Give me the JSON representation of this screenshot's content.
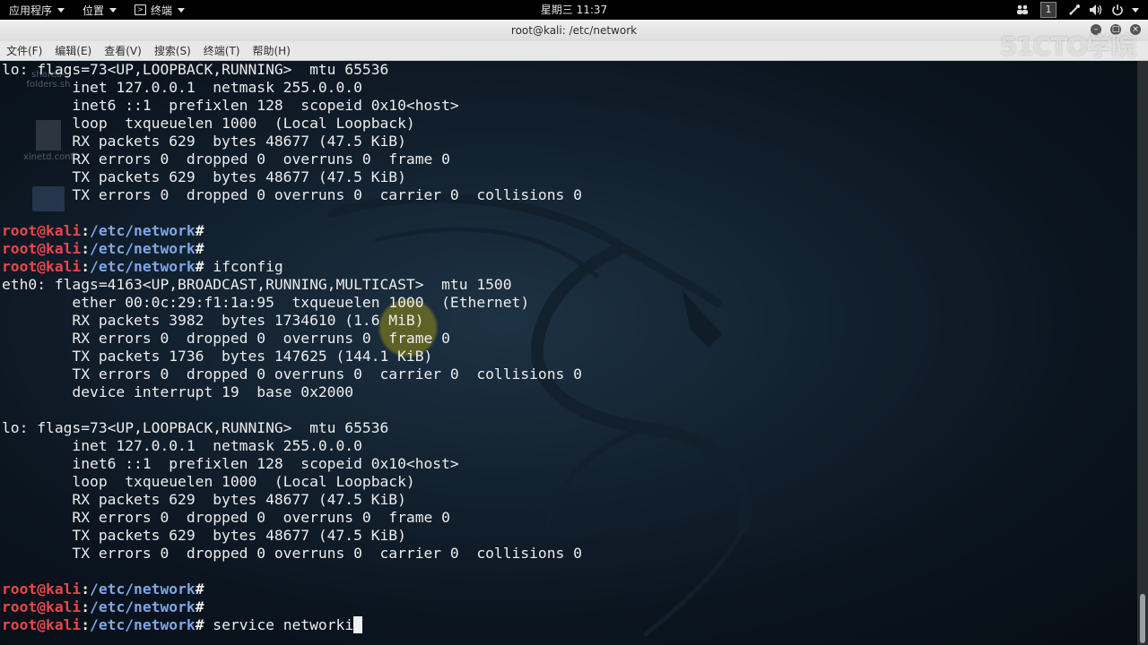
{
  "top_panel": {
    "applications": "应用程序",
    "places": "位置",
    "terminal_app": "终端",
    "clock": "星期三 11:37",
    "workspace": "1"
  },
  "window": {
    "title": "root@kali: /etc/network",
    "menu": [
      "文件(F)",
      "编辑(E)",
      "查看(V)",
      "搜索(S)",
      "终端(T)",
      "帮助(H)"
    ],
    "watermark": "51CTO学院"
  },
  "desktop_icons": [
    {
      "label": "shared-\nfolders.sh"
    },
    {
      "label": "xinetd.conf"
    }
  ],
  "prompt": {
    "user": "root@kali",
    "path": "/etc/network"
  },
  "terminal_lines": [
    {
      "type": "out",
      "text": "lo: flags=73<UP,LOOPBACK,RUNNING>  mtu 65536"
    },
    {
      "type": "out",
      "text": "        inet 127.0.0.1  netmask 255.0.0.0"
    },
    {
      "type": "out",
      "text": "        inet6 ::1  prefixlen 128  scopeid 0x10<host>"
    },
    {
      "type": "out",
      "text": "        loop  txqueuelen 1000  (Local Loopback)"
    },
    {
      "type": "out",
      "text": "        RX packets 629  bytes 48677 (47.5 KiB)"
    },
    {
      "type": "out",
      "text": "        RX errors 0  dropped 0  overruns 0  frame 0"
    },
    {
      "type": "out",
      "text": "        TX packets 629  bytes 48677 (47.5 KiB)"
    },
    {
      "type": "out",
      "text": "        TX errors 0  dropped 0 overruns 0  carrier 0  collisions 0"
    },
    {
      "type": "out",
      "text": ""
    },
    {
      "type": "prompt",
      "cmd": ""
    },
    {
      "type": "prompt",
      "cmd": ""
    },
    {
      "type": "prompt",
      "cmd": " ifconfig"
    },
    {
      "type": "out",
      "text": "eth0: flags=4163<UP,BROADCAST,RUNNING,MULTICAST>  mtu 1500"
    },
    {
      "type": "out",
      "text": "        ether 00:0c:29:f1:1a:95  txqueuelen 1000  (Ethernet)"
    },
    {
      "type": "out",
      "text": "        RX packets 3982  bytes 1734610 (1.6 MiB)"
    },
    {
      "type": "out",
      "text": "        RX errors 0  dropped 0  overruns 0  frame 0"
    },
    {
      "type": "out",
      "text": "        TX packets 1736  bytes 147625 (144.1 KiB)"
    },
    {
      "type": "out",
      "text": "        TX errors 0  dropped 0 overruns 0  carrier 0  collisions 0"
    },
    {
      "type": "out",
      "text": "        device interrupt 19  base 0x2000"
    },
    {
      "type": "out",
      "text": ""
    },
    {
      "type": "out",
      "text": "lo: flags=73<UP,LOOPBACK,RUNNING>  mtu 65536"
    },
    {
      "type": "out",
      "text": "        inet 127.0.0.1  netmask 255.0.0.0"
    },
    {
      "type": "out",
      "text": "        inet6 ::1  prefixlen 128  scopeid 0x10<host>"
    },
    {
      "type": "out",
      "text": "        loop  txqueuelen 1000  (Local Loopback)"
    },
    {
      "type": "out",
      "text": "        RX packets 629  bytes 48677 (47.5 KiB)"
    },
    {
      "type": "out",
      "text": "        RX errors 0  dropped 0  overruns 0  frame 0"
    },
    {
      "type": "out",
      "text": "        TX packets 629  bytes 48677 (47.5 KiB)"
    },
    {
      "type": "out",
      "text": "        TX errors 0  dropped 0 overruns 0  carrier 0  collisions 0"
    },
    {
      "type": "out",
      "text": ""
    },
    {
      "type": "prompt",
      "cmd": ""
    },
    {
      "type": "prompt",
      "cmd": ""
    },
    {
      "type": "prompt",
      "cmd": " service networki",
      "cursor": true
    }
  ],
  "colors": {
    "prompt_user": "#e8474c",
    "prompt_path": "#7ea6e6",
    "terminal_text": "#ececec",
    "terminal_bg": "#0a1018"
  }
}
